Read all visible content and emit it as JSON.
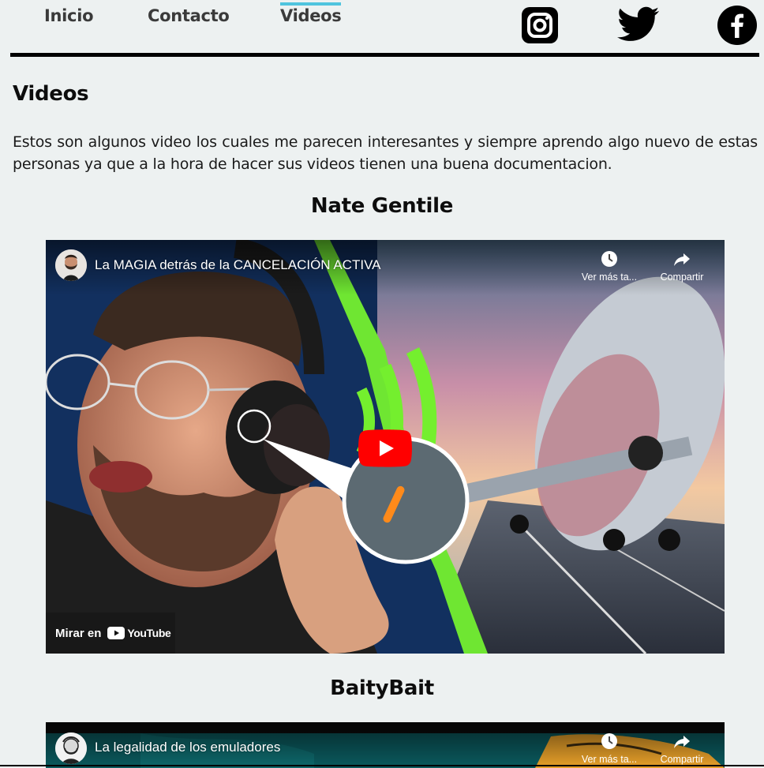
{
  "nav": {
    "links": [
      {
        "label": "Inicio"
      },
      {
        "label": "Contacto"
      },
      {
        "label": "Videos",
        "active": true
      }
    ],
    "social": [
      "instagram-icon",
      "twitter-icon",
      "facebook-icon"
    ],
    "accent": "#4fc4de"
  },
  "page": {
    "title": "Videos",
    "intro": "Estos son algunos video los cuales me parecen interesantes y siempre aprendo algo nuevo de estas personas ya que a la hora de hacer sus videos tienen una buena documentacion."
  },
  "sections": [
    {
      "heading": "Nate Gentile",
      "video": {
        "title": "La MAGIA detrás de la CANCELACIÓN ACTIVA",
        "watch_later": "Ver más ta...",
        "share": "Compartir",
        "watch_on": "Mirar en",
        "platform": "YouTube"
      }
    },
    {
      "heading": "BaityBait",
      "video": {
        "title": "La legalidad de los emuladores",
        "watch_later": "Ver más ta...",
        "share": "Compartir"
      }
    }
  ]
}
